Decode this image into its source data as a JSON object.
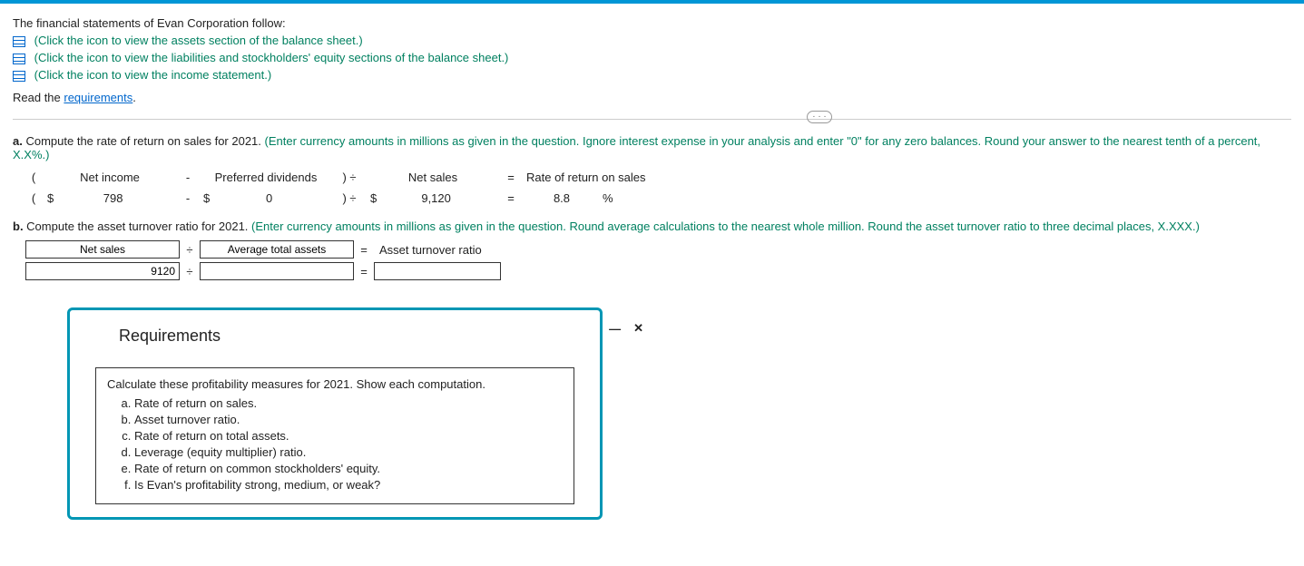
{
  "intro": "The financial statements of Evan Corporation follow:",
  "links": {
    "assets": "(Click the icon to view the assets section of the balance sheet.)",
    "liab": "(Click the icon to view the liabilities and stockholders' equity sections of the balance sheet.)",
    "income": "(Click the icon to view the income statement.)"
  },
  "read_the": "Read the ",
  "requirements_link": "requirements",
  "period": ".",
  "ellipsis": "· · ·",
  "partA": {
    "prefix": "a. ",
    "text": "Compute the rate of return on sales for 2021. ",
    "hint": "(Enter currency amounts in millions as given in the question. Ignore interest expense in your analysis and enter \"0\" for any zero balances. Round your answer to the nearest tenth of a percent, X.X%.)",
    "labels": {
      "net_income": "Net income",
      "pref_div": "Preferred dividends",
      "net_sales": "Net sales",
      "result": "Rate of return on sales"
    },
    "vals": {
      "dollar": "$",
      "net_income": "798",
      "pref_div": "0",
      "net_sales": "9,120",
      "result": "8.8",
      "pct": "%"
    },
    "ops": {
      "minus": "-",
      "paren_div": ") ÷",
      "eq": "="
    }
  },
  "partB": {
    "prefix": "b. ",
    "text": "Compute the asset turnover ratio for 2021. ",
    "hint": "(Enter currency amounts in millions as given in the question. Round average calculations to the nearest whole million. Round the asset turnover ratio to three decimal places, X.XXX.)",
    "labels": {
      "net_sales": "Net sales",
      "avg_assets": "Average total assets",
      "result": "Asset turnover ratio"
    },
    "vals": {
      "net_sales": "9120"
    },
    "ops": {
      "div": "÷",
      "eq": "="
    }
  },
  "modal": {
    "title": "Requirements",
    "intro": "Calculate these profitability measures for 2021. Show each computation.",
    "items": [
      "Rate of return on sales.",
      "Asset turnover ratio.",
      "Rate of return on total assets.",
      "Leverage (equity multiplier) ratio.",
      "Rate of return on common stockholders' equity.",
      "Is Evan's profitability strong, medium, or weak?"
    ],
    "minimize": "—",
    "close": "✕"
  }
}
